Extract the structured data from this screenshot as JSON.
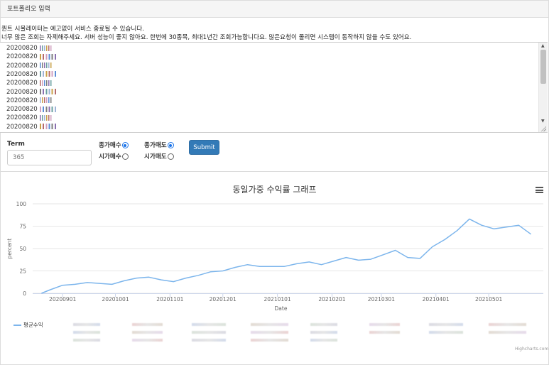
{
  "panel": {
    "title": "포트폴리오 입력"
  },
  "notice": {
    "line1": "퀀트 시뮬레이터는 예고없이 서비스 종료될 수 있습니다.",
    "line2": "너무 많은 조회는 자제해주세요. 서버 성능이 좋지 않아요. 한번에 30종목, 최대1년간 조회가능합니다요. 많은요청이 몰리면 시스템이 동작하지 않을 수도 있어요."
  },
  "portfolio_lines": [
    "20200820",
    "20200820",
    "20200820",
    "20200820",
    "20200820",
    "20200820",
    "20200820",
    "20200820",
    "20200820",
    "20200820"
  ],
  "form": {
    "term_label": "Term",
    "term_placeholder": "365",
    "buy_close": "종가매수",
    "sell_close": "종가매도",
    "buy_open": "시가매수",
    "sell_open": "시가매도",
    "submit_label": "Submit"
  },
  "chart_data": {
    "type": "line",
    "title": "동일가중 수익률 그래프",
    "xlabel": "Date",
    "ylabel": "percent",
    "ylim": [
      0,
      100
    ],
    "yticks": [
      "0",
      "25",
      "50",
      "75",
      "100"
    ],
    "xticks": [
      "20200901",
      "20201001",
      "20201101",
      "20201201",
      "20210101",
      "20210201",
      "20210301",
      "20210401",
      "20210501"
    ],
    "series": [
      {
        "name": "평균수익",
        "color": "#7cb5ec",
        "x": [
          "20200820",
          "20200825",
          "20200901",
          "20200908",
          "20200915",
          "20200922",
          "20200929",
          "20201006",
          "20201013",
          "20201020",
          "20201027",
          "20201103",
          "20201110",
          "20201117",
          "20201124",
          "20201201",
          "20201208",
          "20201215",
          "20201222",
          "20201229",
          "20210105",
          "20210112",
          "20210119",
          "20210126",
          "20210202",
          "20210209",
          "20210216",
          "20210223",
          "20210302",
          "20210309",
          "20210316",
          "20210323",
          "20210330",
          "20210406",
          "20210413",
          "20210420",
          "20210427",
          "20210504",
          "20210511",
          "20210518",
          "20210525"
        ],
        "values": [
          0,
          4,
          9,
          10,
          12,
          11,
          10,
          14,
          17,
          18,
          15,
          13,
          17,
          20,
          24,
          25,
          29,
          32,
          30,
          30,
          30,
          33,
          35,
          32,
          36,
          40,
          37,
          38,
          43,
          48,
          40,
          39,
          52,
          60,
          70,
          83,
          76,
          72,
          74,
          76,
          66
        ]
      }
    ],
    "legend_placement": "bottom",
    "credits": "Highcharts.com"
  }
}
